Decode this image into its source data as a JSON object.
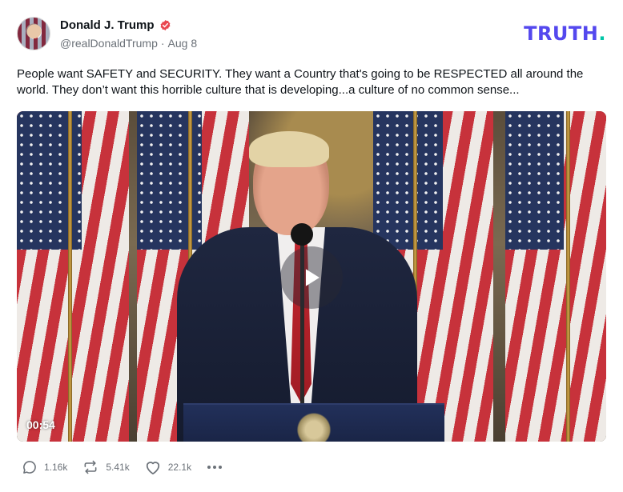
{
  "author": {
    "display_name": "Donald J. Trump",
    "handle": "@realDonaldTrump",
    "separator": "·",
    "date": "Aug 8",
    "avatar_icon": "avatar-flag-portrait",
    "verified_icon": "verified-badge-icon"
  },
  "brand": {
    "logo_text": "TRUTH",
    "logo_dot": ".",
    "primary_color": "#5448ee",
    "accent_color": "#00c6a7"
  },
  "post": {
    "text": "People want SAFETY and SECURITY. They want a Country that's going to be RESPECTED all around the world. They don’t want this horrible culture that is developing...a culture of no common sense..."
  },
  "video": {
    "duration": "00:54",
    "play_icon": "play-icon"
  },
  "actions": {
    "replies": {
      "icon": "reply-icon",
      "count": "1.16k"
    },
    "retruths": {
      "icon": "retruth-icon",
      "count": "5.41k"
    },
    "likes": {
      "icon": "heart-icon",
      "count": "22.1k"
    },
    "more_icon": "more-icon"
  },
  "colors": {
    "text": "#0f1419",
    "muted": "#6b7178",
    "verified": "#e9464f"
  }
}
